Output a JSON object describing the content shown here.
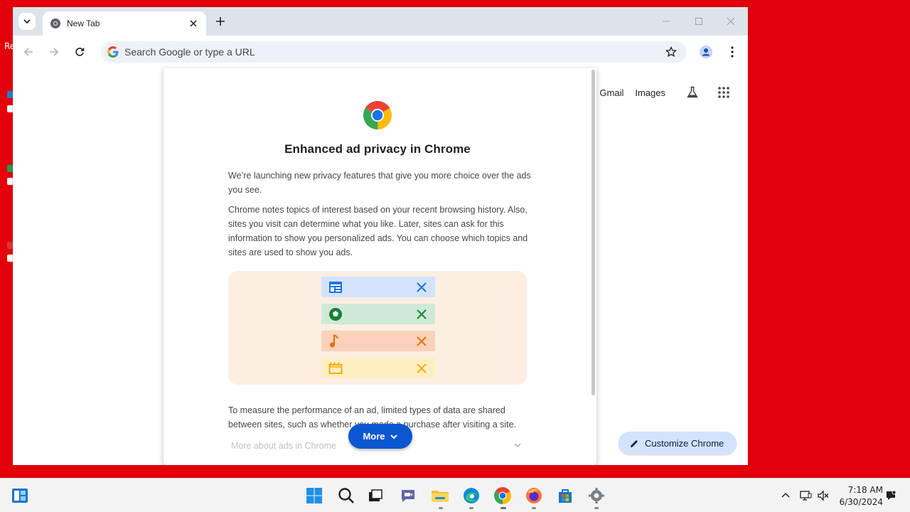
{
  "desktop": {
    "fragment_text": "Re"
  },
  "browser": {
    "tab": {
      "title": "New Tab"
    },
    "omnibox": {
      "placeholder": "Search Google or type a URL"
    }
  },
  "ntp": {
    "links": [
      "Gmail",
      "Images"
    ],
    "customize_label": "Customize Chrome"
  },
  "dialog": {
    "title": "Enhanced ad privacy in Chrome",
    "paragraphs": [
      "We’re launching new privacy features that give you more choice over the ads you see.",
      "Chrome notes topics of interest based on your recent browsing history. Also, sites you visit can determine what you like. Later, sites can ask for this information to show you personalized ads. You can choose which topics and sites are used to show you ads.",
      "To measure the performance of an ad, limited types of data are shared between sites, such as whether you made a purchase after visiting a site."
    ],
    "illustration_rows": [
      {
        "icon": "news-icon",
        "color": "#1a73e8",
        "bg": "#d3e3fd"
      },
      {
        "icon": "soccer-icon",
        "color": "#188038",
        "bg": "#ceead6"
      },
      {
        "icon": "music-note-icon",
        "color": "#e8710a",
        "bg": "#fad2bb"
      },
      {
        "icon": "movie-icon",
        "color": "#f9ab00",
        "bg": "#feefc3"
      }
    ],
    "more_button": "More",
    "faded_link": "More about ads in Chrome"
  },
  "taskbar": {
    "time": "7:18 AM",
    "date": "6/30/2024"
  },
  "colors": {
    "desktop_bg": "#e3000b",
    "accent": "#0b57d0",
    "titlebar": "#dde3ea"
  }
}
